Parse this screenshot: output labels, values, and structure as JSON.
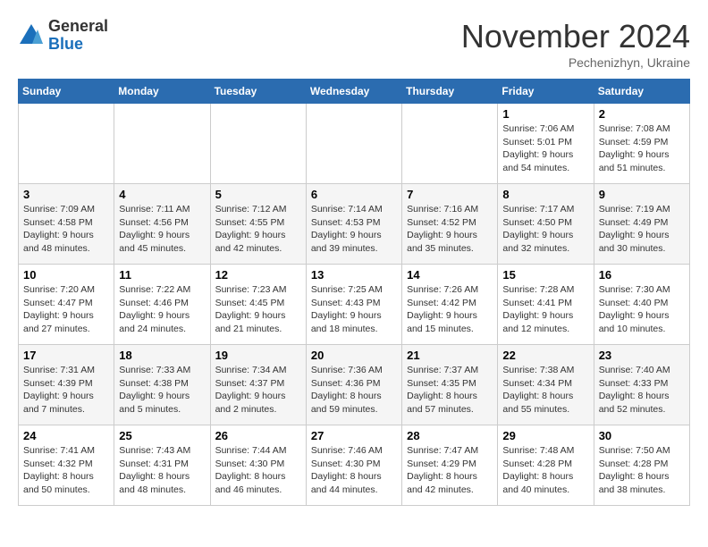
{
  "logo": {
    "general": "General",
    "blue": "Blue"
  },
  "header": {
    "month": "November 2024",
    "location": "Pechenizhyn, Ukraine"
  },
  "weekdays": [
    "Sunday",
    "Monday",
    "Tuesday",
    "Wednesday",
    "Thursday",
    "Friday",
    "Saturday"
  ],
  "weeks": [
    [
      {
        "day": "",
        "info": ""
      },
      {
        "day": "",
        "info": ""
      },
      {
        "day": "",
        "info": ""
      },
      {
        "day": "",
        "info": ""
      },
      {
        "day": "",
        "info": ""
      },
      {
        "day": "1",
        "info": "Sunrise: 7:06 AM\nSunset: 5:01 PM\nDaylight: 9 hours and 54 minutes."
      },
      {
        "day": "2",
        "info": "Sunrise: 7:08 AM\nSunset: 4:59 PM\nDaylight: 9 hours and 51 minutes."
      }
    ],
    [
      {
        "day": "3",
        "info": "Sunrise: 7:09 AM\nSunset: 4:58 PM\nDaylight: 9 hours and 48 minutes."
      },
      {
        "day": "4",
        "info": "Sunrise: 7:11 AM\nSunset: 4:56 PM\nDaylight: 9 hours and 45 minutes."
      },
      {
        "day": "5",
        "info": "Sunrise: 7:12 AM\nSunset: 4:55 PM\nDaylight: 9 hours and 42 minutes."
      },
      {
        "day": "6",
        "info": "Sunrise: 7:14 AM\nSunset: 4:53 PM\nDaylight: 9 hours and 39 minutes."
      },
      {
        "day": "7",
        "info": "Sunrise: 7:16 AM\nSunset: 4:52 PM\nDaylight: 9 hours and 35 minutes."
      },
      {
        "day": "8",
        "info": "Sunrise: 7:17 AM\nSunset: 4:50 PM\nDaylight: 9 hours and 32 minutes."
      },
      {
        "day": "9",
        "info": "Sunrise: 7:19 AM\nSunset: 4:49 PM\nDaylight: 9 hours and 30 minutes."
      }
    ],
    [
      {
        "day": "10",
        "info": "Sunrise: 7:20 AM\nSunset: 4:47 PM\nDaylight: 9 hours and 27 minutes."
      },
      {
        "day": "11",
        "info": "Sunrise: 7:22 AM\nSunset: 4:46 PM\nDaylight: 9 hours and 24 minutes."
      },
      {
        "day": "12",
        "info": "Sunrise: 7:23 AM\nSunset: 4:45 PM\nDaylight: 9 hours and 21 minutes."
      },
      {
        "day": "13",
        "info": "Sunrise: 7:25 AM\nSunset: 4:43 PM\nDaylight: 9 hours and 18 minutes."
      },
      {
        "day": "14",
        "info": "Sunrise: 7:26 AM\nSunset: 4:42 PM\nDaylight: 9 hours and 15 minutes."
      },
      {
        "day": "15",
        "info": "Sunrise: 7:28 AM\nSunset: 4:41 PM\nDaylight: 9 hours and 12 minutes."
      },
      {
        "day": "16",
        "info": "Sunrise: 7:30 AM\nSunset: 4:40 PM\nDaylight: 9 hours and 10 minutes."
      }
    ],
    [
      {
        "day": "17",
        "info": "Sunrise: 7:31 AM\nSunset: 4:39 PM\nDaylight: 9 hours and 7 minutes."
      },
      {
        "day": "18",
        "info": "Sunrise: 7:33 AM\nSunset: 4:38 PM\nDaylight: 9 hours and 5 minutes."
      },
      {
        "day": "19",
        "info": "Sunrise: 7:34 AM\nSunset: 4:37 PM\nDaylight: 9 hours and 2 minutes."
      },
      {
        "day": "20",
        "info": "Sunrise: 7:36 AM\nSunset: 4:36 PM\nDaylight: 8 hours and 59 minutes."
      },
      {
        "day": "21",
        "info": "Sunrise: 7:37 AM\nSunset: 4:35 PM\nDaylight: 8 hours and 57 minutes."
      },
      {
        "day": "22",
        "info": "Sunrise: 7:38 AM\nSunset: 4:34 PM\nDaylight: 8 hours and 55 minutes."
      },
      {
        "day": "23",
        "info": "Sunrise: 7:40 AM\nSunset: 4:33 PM\nDaylight: 8 hours and 52 minutes."
      }
    ],
    [
      {
        "day": "24",
        "info": "Sunrise: 7:41 AM\nSunset: 4:32 PM\nDaylight: 8 hours and 50 minutes."
      },
      {
        "day": "25",
        "info": "Sunrise: 7:43 AM\nSunset: 4:31 PM\nDaylight: 8 hours and 48 minutes."
      },
      {
        "day": "26",
        "info": "Sunrise: 7:44 AM\nSunset: 4:30 PM\nDaylight: 8 hours and 46 minutes."
      },
      {
        "day": "27",
        "info": "Sunrise: 7:46 AM\nSunset: 4:30 PM\nDaylight: 8 hours and 44 minutes."
      },
      {
        "day": "28",
        "info": "Sunrise: 7:47 AM\nSunset: 4:29 PM\nDaylight: 8 hours and 42 minutes."
      },
      {
        "day": "29",
        "info": "Sunrise: 7:48 AM\nSunset: 4:28 PM\nDaylight: 8 hours and 40 minutes."
      },
      {
        "day": "30",
        "info": "Sunrise: 7:50 AM\nSunset: 4:28 PM\nDaylight: 8 hours and 38 minutes."
      }
    ]
  ]
}
